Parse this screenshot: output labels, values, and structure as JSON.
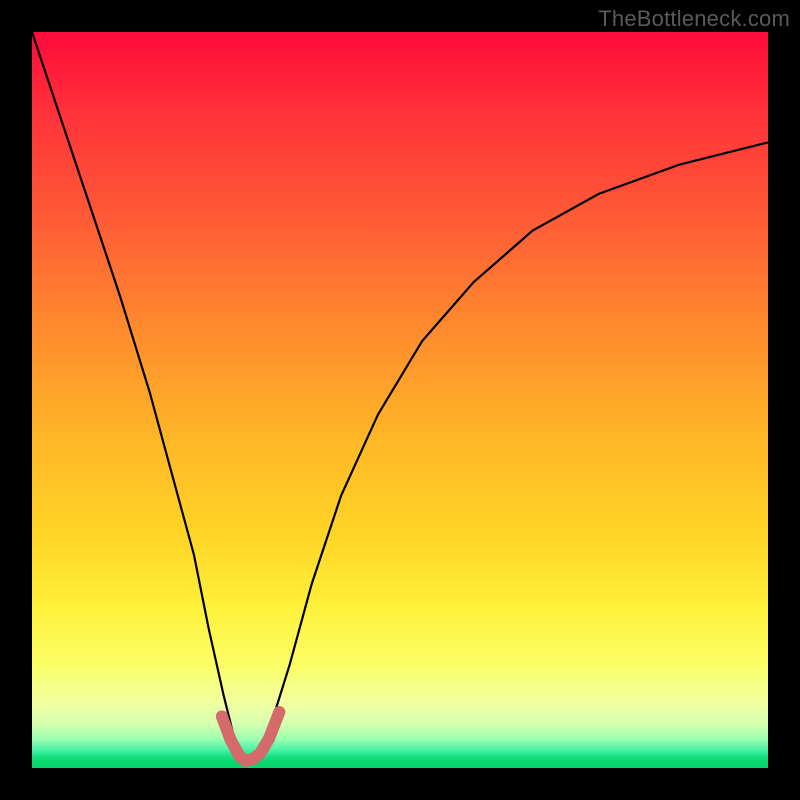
{
  "watermark": "TheBottleneck.com",
  "chart_data": {
    "type": "line",
    "title": "",
    "xlabel": "",
    "ylabel": "",
    "xlim": [
      0,
      100
    ],
    "ylim": [
      0,
      100
    ],
    "grid": false,
    "legend": null,
    "background_gradient": {
      "direction": "vertical",
      "stops": [
        {
          "pos": 0,
          "color": "#ff0a3a"
        },
        {
          "pos": 0.55,
          "color": "#ffb627"
        },
        {
          "pos": 0.86,
          "color": "#fbff66"
        },
        {
          "pos": 0.97,
          "color": "#4cf2a6"
        },
        {
          "pos": 1.0,
          "color": "#06d46c"
        }
      ]
    },
    "series": [
      {
        "name": "bottleneck-curve",
        "color": "#000000",
        "x": [
          0,
          4,
          8,
          12,
          16,
          19,
          22,
          24,
          26,
          27.5,
          29,
          30.5,
          32.5,
          35,
          38,
          42,
          47,
          53,
          60,
          68,
          77,
          88,
          100
        ],
        "y": [
          100,
          88,
          76,
          64,
          51,
          40,
          29,
          19,
          10,
          4,
          1,
          2,
          6,
          14,
          25,
          37,
          48,
          58,
          66,
          73,
          78,
          82,
          85
        ]
      }
    ],
    "markers": {
      "color": "#d46a6a",
      "radius": 6,
      "x": [
        25.8,
        27.0,
        28.2,
        29.0,
        30.0,
        31.0,
        32.2,
        33.6
      ],
      "y": [
        7.0,
        3.8,
        1.6,
        1.0,
        1.2,
        2.0,
        4.0,
        7.6
      ]
    },
    "minimum": {
      "x": 29,
      "y": 1
    }
  }
}
